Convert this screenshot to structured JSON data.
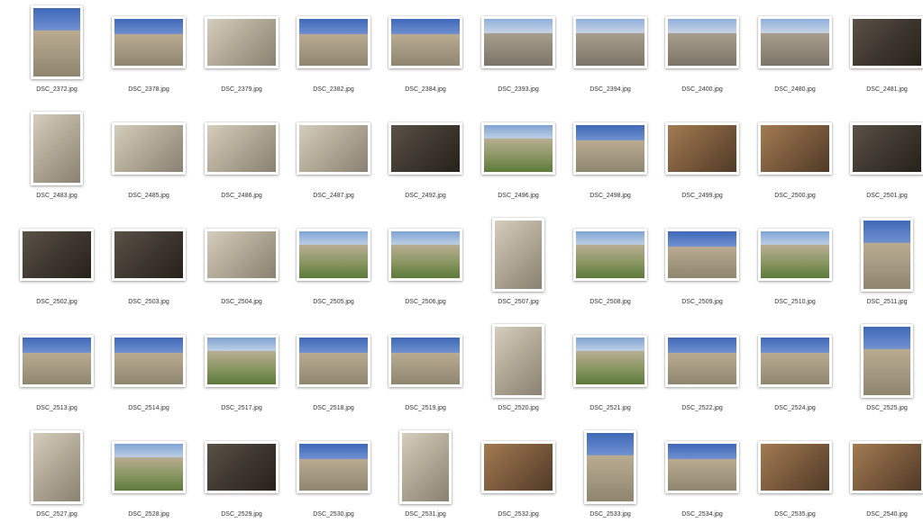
{
  "items": [
    {
      "name": "DSC_2372.jpg",
      "o": "p",
      "s": "blue"
    },
    {
      "name": "DSC_2378.jpg",
      "o": "l",
      "s": "blue"
    },
    {
      "name": "DSC_2379.jpg",
      "o": "l",
      "s": "stone"
    },
    {
      "name": "DSC_2382.jpg",
      "o": "l",
      "s": "blue"
    },
    {
      "name": "DSC_2384.jpg",
      "o": "l",
      "s": "blue"
    },
    {
      "name": "DSC_2393.jpg",
      "o": "l",
      "s": "sky"
    },
    {
      "name": "DSC_2394.jpg",
      "o": "l",
      "s": "sky"
    },
    {
      "name": "DSC_2400.jpg",
      "o": "l",
      "s": "sky"
    },
    {
      "name": "DSC_2480.jpg",
      "o": "l",
      "s": "sky"
    },
    {
      "name": "DSC_2481.jpg",
      "o": "l",
      "s": "dark"
    },
    {
      "name": "DSC_2483.jpg",
      "o": "p",
      "s": "stone"
    },
    {
      "name": "DSC_2485.jpg",
      "o": "l",
      "s": "stone"
    },
    {
      "name": "DSC_2486.jpg",
      "o": "l",
      "s": "stone"
    },
    {
      "name": "DSC_2487.jpg",
      "o": "l",
      "s": "stone"
    },
    {
      "name": "DSC_2492.jpg",
      "o": "l",
      "s": "dark"
    },
    {
      "name": "DSC_2496.jpg",
      "o": "l",
      "s": "green"
    },
    {
      "name": "DSC_2498.jpg",
      "o": "l",
      "s": "blue"
    },
    {
      "name": "DSC_2499.jpg",
      "o": "l",
      "s": "brown"
    },
    {
      "name": "DSC_2500.jpg",
      "o": "l",
      "s": "brown"
    },
    {
      "name": "DSC_2501.jpg",
      "o": "l",
      "s": "dark"
    },
    {
      "name": "DSC_2502.jpg",
      "o": "l",
      "s": "dark"
    },
    {
      "name": "DSC_2503.jpg",
      "o": "l",
      "s": "dark"
    },
    {
      "name": "DSC_2504.jpg",
      "o": "l",
      "s": "stone"
    },
    {
      "name": "DSC_2505.jpg",
      "o": "l",
      "s": "green"
    },
    {
      "name": "DSC_2506.jpg",
      "o": "l",
      "s": "green"
    },
    {
      "name": "DSC_2507.jpg",
      "o": "p",
      "s": "stone"
    },
    {
      "name": "DSC_2508.jpg",
      "o": "l",
      "s": "green"
    },
    {
      "name": "DSC_2509.jpg",
      "o": "l",
      "s": "blue"
    },
    {
      "name": "DSC_2510.jpg",
      "o": "l",
      "s": "green"
    },
    {
      "name": "DSC_2511.jpg",
      "o": "p",
      "s": "blue"
    },
    {
      "name": "DSC_2513.jpg",
      "o": "l",
      "s": "blue"
    },
    {
      "name": "DSC_2514.jpg",
      "o": "l",
      "s": "blue"
    },
    {
      "name": "DSC_2517.jpg",
      "o": "l",
      "s": "green"
    },
    {
      "name": "DSC_2518.jpg",
      "o": "l",
      "s": "blue"
    },
    {
      "name": "DSC_2519.jpg",
      "o": "l",
      "s": "blue"
    },
    {
      "name": "DSC_2520.jpg",
      "o": "p",
      "s": "stone"
    },
    {
      "name": "DSC_2521.jpg",
      "o": "l",
      "s": "green"
    },
    {
      "name": "DSC_2522.jpg",
      "o": "l",
      "s": "blue"
    },
    {
      "name": "DSC_2524.jpg",
      "o": "l",
      "s": "blue"
    },
    {
      "name": "DSC_2525.jpg",
      "o": "p",
      "s": "blue"
    },
    {
      "name": "DSC_2527.jpg",
      "o": "p",
      "s": "stone"
    },
    {
      "name": "DSC_2528.jpg",
      "o": "l",
      "s": "green"
    },
    {
      "name": "DSC_2529.jpg",
      "o": "l",
      "s": "dark"
    },
    {
      "name": "DSC_2530.jpg",
      "o": "l",
      "s": "blue"
    },
    {
      "name": "DSC_2531.jpg",
      "o": "p",
      "s": "stone"
    },
    {
      "name": "DSC_2532.jpg",
      "o": "l",
      "s": "brown"
    },
    {
      "name": "DSC_2533.jpg",
      "o": "p",
      "s": "blue"
    },
    {
      "name": "DSC_2534.jpg",
      "o": "l",
      "s": "blue"
    },
    {
      "name": "DSC_2535.jpg",
      "o": "l",
      "s": "brown"
    },
    {
      "name": "DSC_2540.jpg",
      "o": "l",
      "s": "brown"
    }
  ],
  "swatches": {
    "blue": "linear-gradient(#3f68b8 0%, #6f90cf 32%, #b9ab90 33%, #8f8670 100%)",
    "sky": "linear-gradient(#8fb0dc 0%, #c7d4e6 30%, #a69d8c 31%, #7c7466 100%)",
    "stone": "linear-gradient(135deg, #d5cdbd 0%, #b3aa98 45%, #8a8172 100%)",
    "dark": "linear-gradient(135deg, #5a5246 0%, #3c352d 55%, #272219 100%)",
    "green": "linear-gradient(#7fa3d4 0%, #bccfe5 28%, #b8ad93 29%, #8f9a67 62%, #5b7a3a 100%)",
    "brown": "linear-gradient(135deg, #a27b52 0%, #7a5a3c 50%, #4f3a26 100%)"
  }
}
